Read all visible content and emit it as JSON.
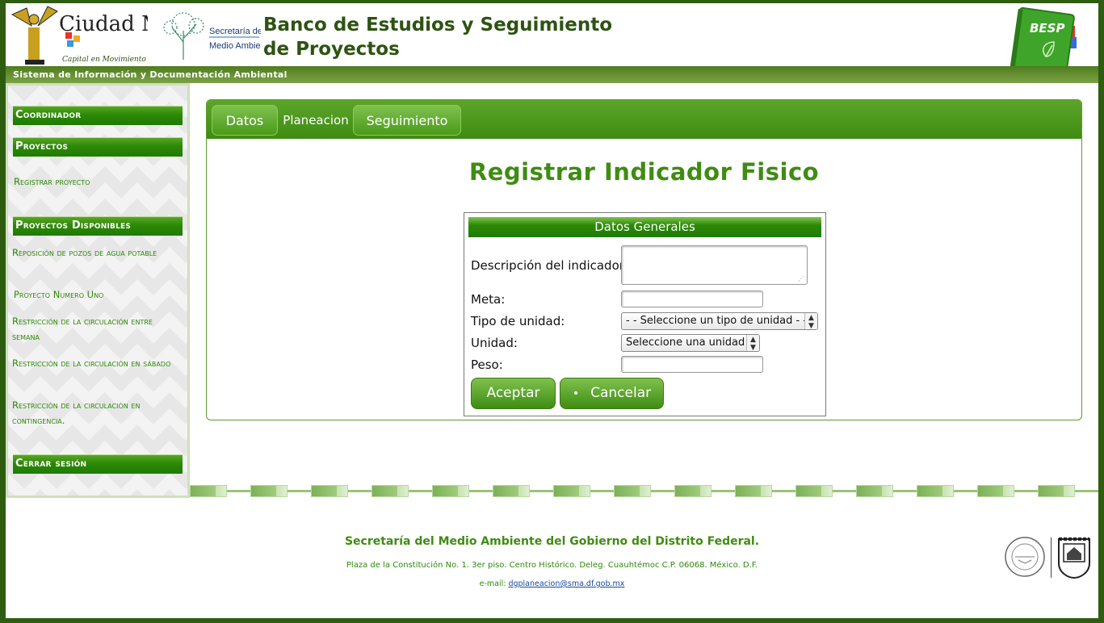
{
  "header": {
    "cdmx_logo_text": "Ciudad México",
    "cdmx_logo_tagline": "Capital en Movimiento",
    "sma_logo_text": [
      "Secretaría del",
      "Medio Ambiente"
    ],
    "site_title": "Banco de Estudios y Seguimiento de Proyectos",
    "besp_badge": "BESP",
    "subtitle": "Sistema de Información y Documentación Ambiental"
  },
  "sidebar": {
    "coordinador": "Coordinador",
    "proyectos": "Proyectos",
    "registrar": "Registrar proyecto",
    "disponibles": "Proyectos Disponibles",
    "items": [
      "Reposición de pozos de agua potable",
      "Proyecto Numero Uno",
      "Restricción de la circulación entre semana",
      "Restricción de la circulación en sábado",
      "Restricción de la circulación en contingencia."
    ],
    "logout": "Cerrar sesión"
  },
  "tabs": {
    "datos": "Datos",
    "planeacion": "Planeacion",
    "seguimiento": "Seguimiento"
  },
  "page_title": "Registrar Indicador Fisico",
  "form": {
    "header": "Datos Generales",
    "descripcion_label": "Descripción del indicador",
    "meta_label": "Meta:",
    "tipo_label": "Tipo de unidad:",
    "tipo_selected": "- - Seleccione un tipo de unidad - -",
    "unidad_label": "Unidad:",
    "unidad_selected": "Seleccione una unidad",
    "peso_label": "Peso:",
    "aceptar": "Aceptar",
    "cancelar": "Cancelar",
    "cancelar_bullet": "•"
  },
  "footer": {
    "title": "Secretaría del Medio Ambiente del Gobierno del Distrito Federal.",
    "address": "Plaza de la Constitución No. 1. 3er piso. Centro Histórico. Deleg. Cuauhtémoc C.P. 06068. México. D.F.",
    "email_label": "e-mail:",
    "email": "dgplaneacion@sma.df.gob.mx"
  },
  "colors": {
    "brand_green": "#3f8c12",
    "dark_green": "#2d5312",
    "border_frame": "#2f5d10"
  },
  "icons": [
    "angel-statue-logo",
    "tree-logo",
    "besp-notebook-icon",
    "leaf-icon",
    "ciudad-con-equidad-seal",
    "coat-of-arms-seal"
  ]
}
